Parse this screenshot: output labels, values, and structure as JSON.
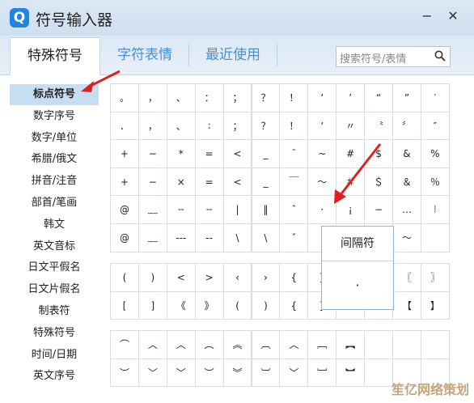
{
  "window": {
    "title": "符号输入器",
    "logo_text": "Q"
  },
  "tabs": [
    {
      "label": "特殊符号",
      "active": true
    },
    {
      "label": "字符表情",
      "active": false
    },
    {
      "label": "最近使用",
      "active": false
    }
  ],
  "search": {
    "placeholder": "搜索符号/表情"
  },
  "sidebar": {
    "items": [
      {
        "label": "标点符号",
        "active": true
      },
      {
        "label": "数字序号"
      },
      {
        "label": "数字/单位"
      },
      {
        "label": "希腊/俄文"
      },
      {
        "label": "拼音/注音"
      },
      {
        "label": "部首/笔画"
      },
      {
        "label": "韩文"
      },
      {
        "label": "英文音标"
      },
      {
        "label": "日文平假名"
      },
      {
        "label": "日文片假名"
      },
      {
        "label": "制表符"
      },
      {
        "label": "特殊符号"
      },
      {
        "label": "时间/日期"
      },
      {
        "label": "英文序号"
      }
    ]
  },
  "grid1": [
    [
      "。",
      "，",
      "、",
      "：",
      "；",
      "？",
      "！",
      "‘",
      "’",
      "“",
      "”",
      "′"
    ],
    [
      "．",
      "，",
      "、",
      "∶",
      "；",
      "？",
      "！",
      "ʼ",
      "〃",
      "〝",
      "〞",
      "″"
    ],
    [
      "+",
      "−",
      "*",
      "=",
      "<",
      "_",
      "¯",
      "~",
      "#",
      "$",
      "&",
      "%"
    ],
    [
      "+",
      "−",
      "×",
      "=",
      "<",
      "_",
      "￣",
      "～",
      "＃",
      "＄",
      "＆",
      "％"
    ],
    [
      "@",
      "﹏",
      "╌",
      "╌",
      "|",
      "‖",
      "ˆ",
      "·",
      "¡",
      "−",
      "…",
      "⦚"
    ],
    [
      "@",
      "﹏",
      "---",
      "--",
      "\\",
      "\\",
      "ˇ",
      "·",
      "",
      "",
      "～",
      ""
    ]
  ],
  "grid2": [
    [
      "(",
      ")",
      "<",
      ">",
      "‹",
      "›",
      "{",
      "}",
      "",
      "",
      "〖",
      "〗"
    ],
    [
      "[",
      "]",
      "《",
      "》",
      "(",
      ")",
      "{",
      "}",
      "",
      "",
      "【",
      "】"
    ]
  ],
  "grid3": [
    [
      "⌒",
      "︿",
      "︿",
      "︵",
      "︽",
      "︹",
      "︿",
      "﹇",
      "︻",
      "",
      "",
      ""
    ],
    [
      "︶",
      "﹀",
      "﹀",
      "︶",
      "︾",
      "︺",
      "﹀",
      "﹈",
      "︼",
      "",
      "",
      ""
    ]
  ],
  "popup": {
    "name": "间隔符",
    "symbol": "·"
  },
  "watermark": "笙亿网络策划",
  "colors": {
    "accent": "#1f86e0",
    "arrow": "#e02020",
    "selected": "#c7ddf2"
  }
}
